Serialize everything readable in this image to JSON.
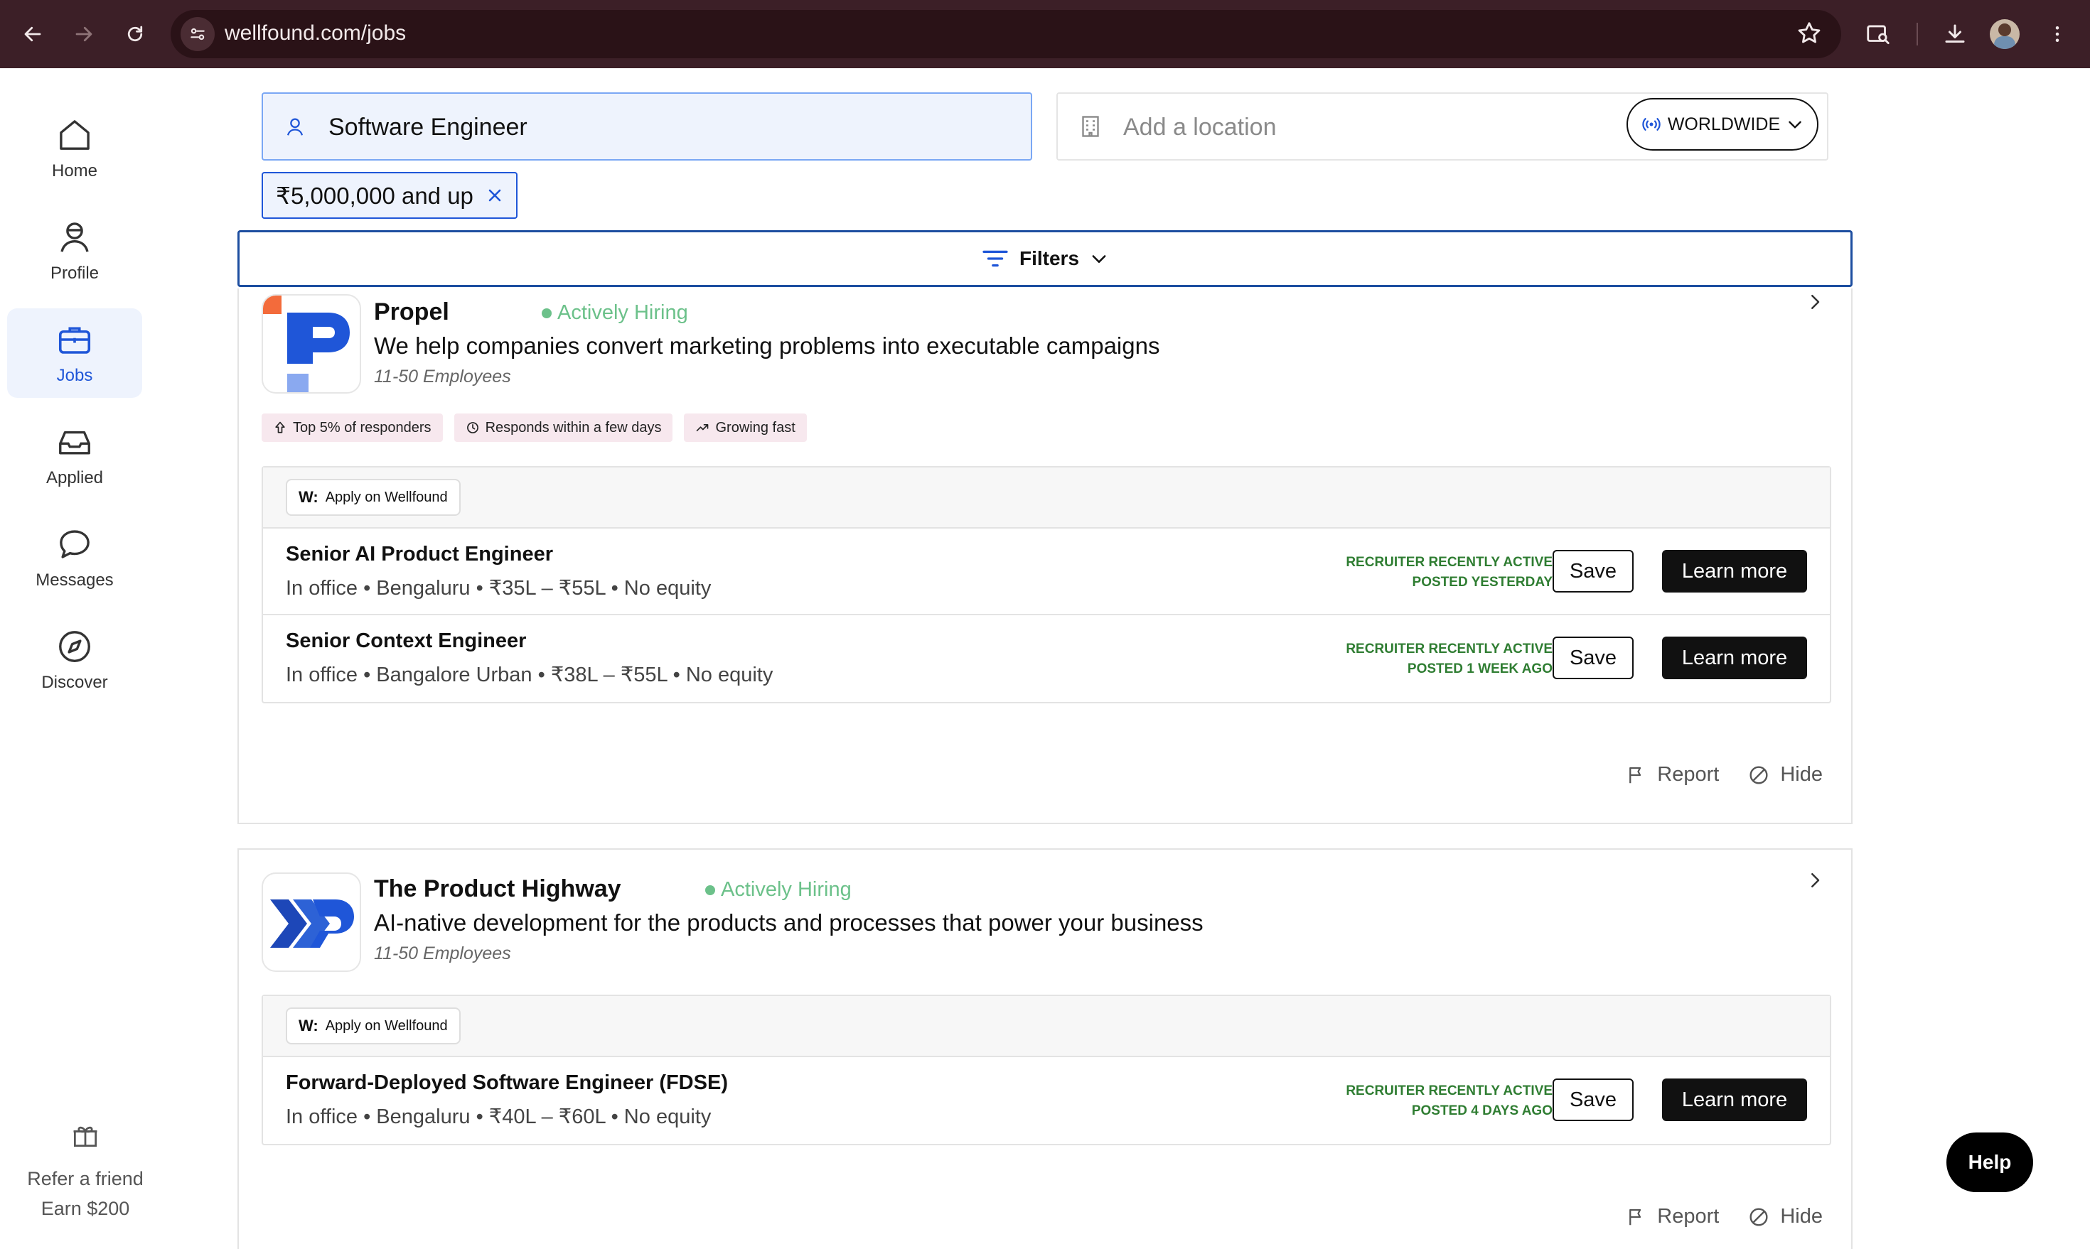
{
  "browser": {
    "url": "wellfound.com/jobs"
  },
  "sidebar": {
    "items": [
      {
        "label": "Home",
        "icon": "home-icon"
      },
      {
        "label": "Profile",
        "icon": "profile-icon"
      },
      {
        "label": "Jobs",
        "icon": "briefcase-icon"
      },
      {
        "label": "Applied",
        "icon": "inbox-icon"
      },
      {
        "label": "Messages",
        "icon": "chat-icon"
      },
      {
        "label": "Discover",
        "icon": "compass-icon"
      }
    ],
    "refer": {
      "line1": "Refer a friend",
      "line2": "Earn $200"
    }
  },
  "search": {
    "role_value": "Software Engineer",
    "location_placeholder": "Add a location",
    "worldwide_label": "WORLDWIDE",
    "salary_chip": "₹5,000,000 and up",
    "filters_label": "Filters"
  },
  "companies": [
    {
      "name": "Propel",
      "hiring": "Actively Hiring",
      "tagline": "We help companies convert marketing problems into executable campaigns",
      "employees": "11-50 Employees",
      "badges": [
        "Top 5% of responders",
        "Responds within a few days",
        "Growing fast"
      ],
      "apply_label": "Apply on Wellfound",
      "jobs": [
        {
          "title": "Senior AI Product Engineer",
          "meta": "In office • Bengaluru • ₹35L – ₹55L • No equity",
          "status1": "RECRUITER RECENTLY ACTIVE",
          "status2": "POSTED YESTERDAY"
        },
        {
          "title": "Senior Context Engineer",
          "meta": "In office • Bangalore Urban • ₹38L – ₹55L • No equity",
          "status1": "RECRUITER RECENTLY ACTIVE",
          "status2": "POSTED 1 WEEK AGO"
        }
      ]
    },
    {
      "name": "The Product Highway",
      "hiring": "Actively Hiring",
      "tagline": "AI-native development for the products and processes that power your business",
      "employees": "11-50 Employees",
      "apply_label": "Apply on Wellfound",
      "jobs": [
        {
          "title": "Forward-Deployed Software Engineer (FDSE)",
          "meta": "In office • Bengaluru • ₹40L – ₹60L • No equity",
          "status1": "RECRUITER RECENTLY ACTIVE",
          "status2": "POSTED 4 DAYS AGO"
        }
      ]
    }
  ],
  "labels": {
    "save": "Save",
    "learn_more": "Learn more",
    "report": "Report",
    "hide": "Hide",
    "help": "Help"
  },
  "colors": {
    "chrome": "#3c1f27",
    "accent": "#1f56d8",
    "hiring_green": "#6cc18a",
    "status_green": "#2f7d32"
  }
}
